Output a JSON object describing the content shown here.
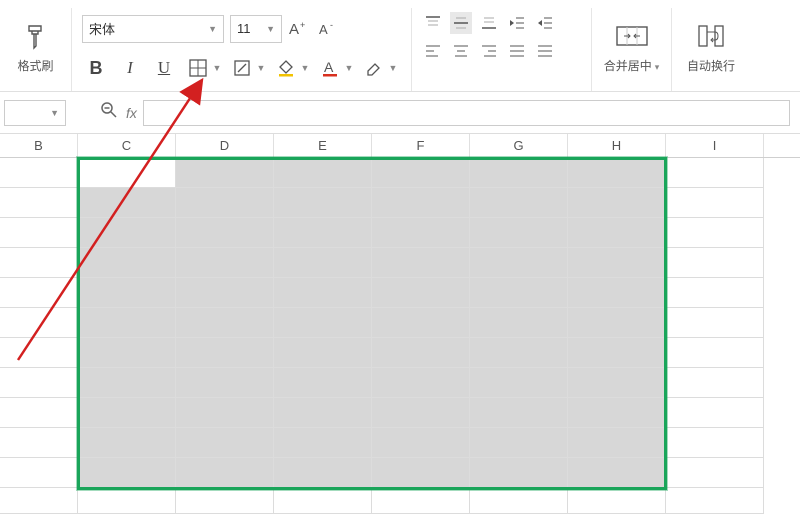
{
  "ribbon": {
    "format_painter": "格式刷",
    "font_name": "宋体",
    "font_size": "11",
    "merge_center": "合并居中",
    "wrap_text": "自动换行"
  },
  "columns": [
    "B",
    "C",
    "D",
    "E",
    "F",
    "G",
    "H",
    "I"
  ],
  "selection": {
    "start_col": "C",
    "end_col": "H",
    "row_count": 11
  }
}
